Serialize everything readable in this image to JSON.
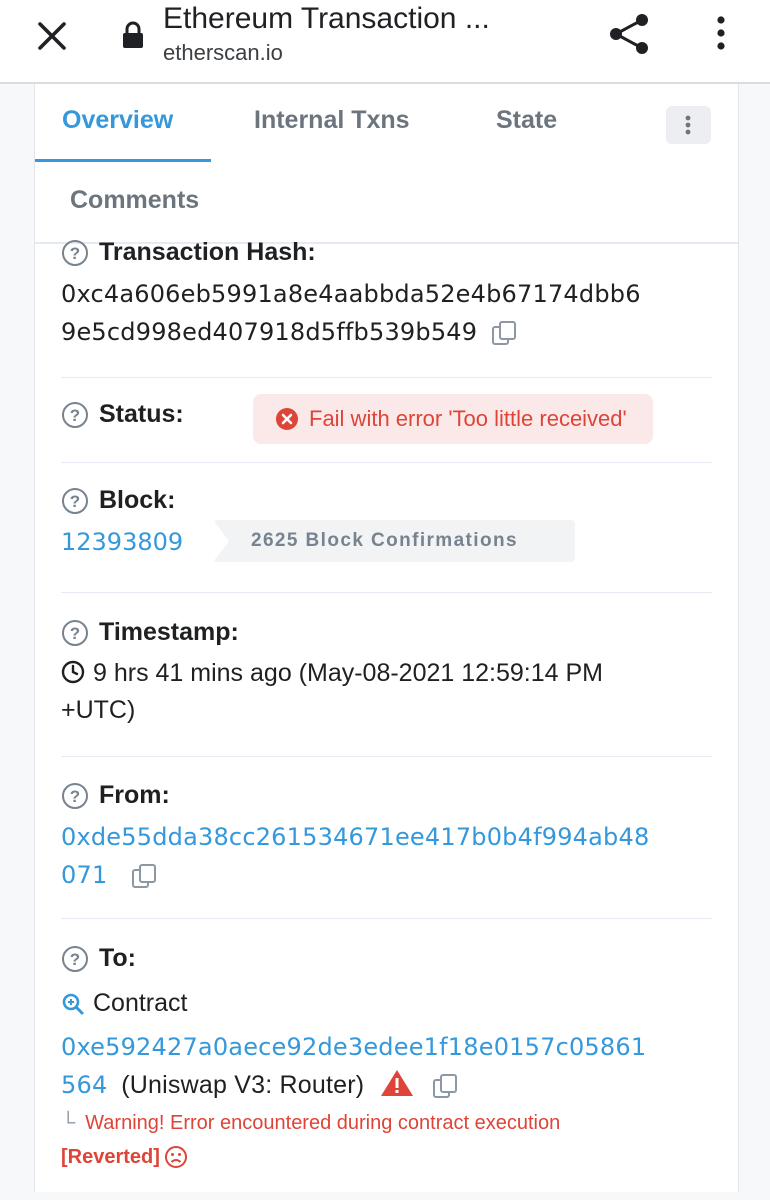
{
  "browser": {
    "title": "Ethereum Transaction ...",
    "url": "etherscan.io",
    "icons": [
      "close-icon",
      "lock-icon",
      "share-icon",
      "more-vert-icon"
    ]
  },
  "tabs": {
    "overview": "Overview",
    "internal": "Internal Txns",
    "state": "State",
    "comments": "Comments"
  },
  "hash": {
    "label": "Transaction Hash:",
    "line1": "0xc4a606eb5991a8e4aabbda52e4b67174dbb6",
    "line2": "9e5cd998ed407918d5ffb539b549"
  },
  "status": {
    "label": "Status:",
    "text": "Fail with error 'Too little received'",
    "color": "#de4437"
  },
  "block": {
    "label": "Block:",
    "number": "12393809",
    "confirmations": "2625 Block Confirmations"
  },
  "timestamp": {
    "label": "Timestamp:",
    "line1": "9 hrs 41 mins ago (May-08-2021 12:59:14 PM",
    "line2": "+UTC)"
  },
  "from": {
    "label": "From:",
    "line1": "0xde55dda38cc261534671ee417b0b4f994ab48",
    "line2": "071"
  },
  "to": {
    "label": "To:",
    "contract": "Contract",
    "line1": "0xe592427a0aece92de3edee1f18e0157c05861",
    "line2": "564",
    "name": "(Uniswap V3: Router)",
    "warning": "Warning! Error encountered during contract execution",
    "reverted": "[Reverted]"
  },
  "colors": {
    "link": "#3498db",
    "error": "#de4437",
    "accent_tab": "#3498db"
  }
}
